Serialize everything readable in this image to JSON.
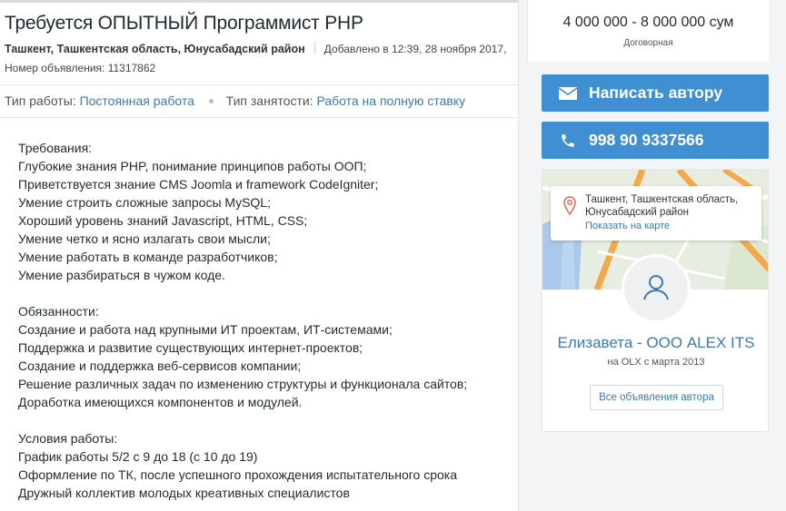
{
  "ad": {
    "title": "Требуется ОПЫТНЫЙ Программист PHP",
    "location": "Ташкент, Ташкентская область, Юнусабадский район",
    "added": "Добавлено в 12:39, 28 ноября 2017,",
    "ad_number": "Номер объявления: 11317862",
    "work_type_label": "Тип работы:",
    "work_type_value": "Постоянная работа",
    "employment_label": "Тип занятости:",
    "employment_value": "Работа на полную ставку",
    "description": [
      "Требования:",
      "Глубокие знания PHP, понимание принципов работы ООП;",
      "Приветствуется знание CMS Joomla и framework CodeIgniter;",
      "Умение строить сложные запросы MySQL;",
      "Хороший уровень знаний Javascript, HTML, CSS;",
      "Умение четко и ясно излагать свои мысли;",
      "Умение работать в команде разработчиков;",
      "Умение разбираться в чужом коде.",
      "",
      "Обязанности:",
      "Создание и работа над крупными ИТ проектам, ИТ-системами;",
      "Поддержка и развитие существующих интернет-проектов;",
      "Создание и поддержка веб-сервисов компании;",
      "Решение различных задач по изменению структуры и функционала сайтов;",
      "Доработка имеющихся компонентов и модулей.",
      "",
      "Условия работы:",
      "График работы 5/2 с 9 до 18 (с 10 до 19)",
      "Оформление по ТК, после успешного прохождения испытательного срока",
      "Дружный коллектив молодых креативных специалистов"
    ]
  },
  "sidebar": {
    "price": "4 000 000 - 8 000 000 сум",
    "price_note": "Договорная",
    "write_button": "Написать автору",
    "phone_button": "998 90 9337566",
    "map_address": "Ташкент, Ташкентская область, Юнусабадский район",
    "show_on_map": "Показать на карте",
    "seller_name": "Елизавета - ООО ALEX ITS",
    "seller_since": "на OLX с марта 2013",
    "all_ads_button": "Все объявления автора"
  },
  "colors": {
    "accent": "#3f8fd2",
    "link": "#3c7ab1"
  },
  "icons": {
    "write": "envelope-icon",
    "phone": "phone-icon",
    "map_pin": "map-pin-icon",
    "avatar": "user-icon"
  }
}
